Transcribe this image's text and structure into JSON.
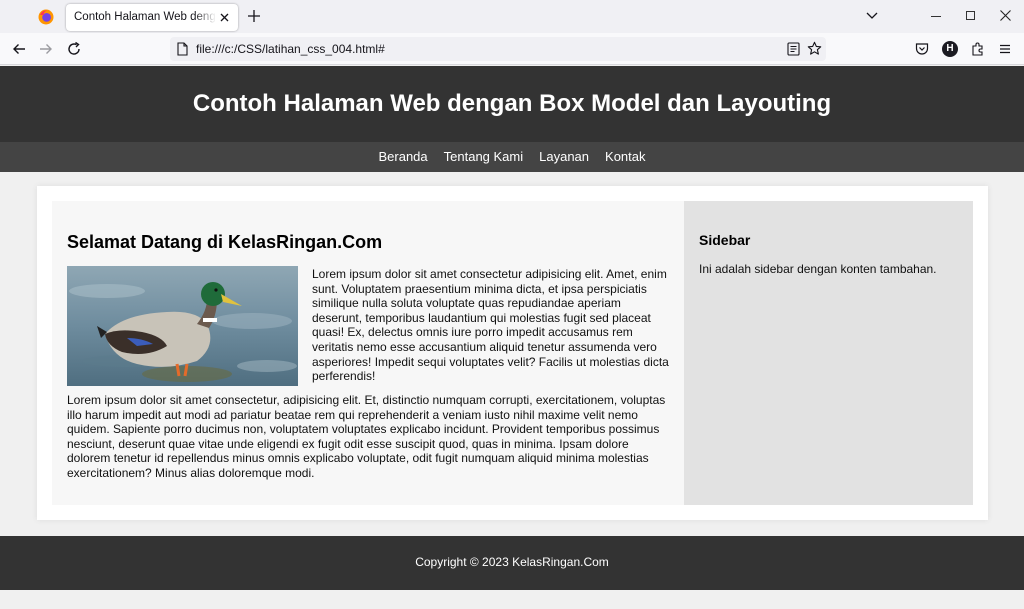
{
  "browser": {
    "tab_title": "Contoh Halaman Web dengan Box Model dan Layouting",
    "url": "file:///c:/CSS/latihan_css_004.html#",
    "avatar_initial": "H"
  },
  "page": {
    "header_title": "Contoh Halaman Web dengan Box Model dan Layouting",
    "nav": [
      "Beranda",
      "Tentang Kami",
      "Layanan",
      "Kontak"
    ],
    "main": {
      "heading": "Selamat Datang di KelasRingan.Com",
      "image": "mallard-duck-photo",
      "paragraph1": "Lorem ipsum dolor sit amet consectetur adipisicing elit. Amet, enim sunt. Voluptatem praesentium minima dicta, et ipsa perspiciatis similique nulla soluta voluptate quas repudiandae aperiam deserunt, temporibus laudantium qui molestias fugit sed placeat quasi! Ex, delectus omnis iure porro impedit accusamus rem veritatis nemo esse accusantium aliquid tenetur assumenda vero asperiores! Impedit sequi voluptates velit? Facilis ut molestias dicta perferendis!",
      "paragraph2": "Lorem ipsum dolor sit amet consectetur, adipisicing elit. Et, distinctio numquam corrupti, exercitationem, voluptas illo harum impedit aut modi ad pariatur beatae rem qui reprehenderit a veniam iusto nihil maxime velit nemo quidem. Sapiente porro ducimus non, voluptatem voluptates explicabo incidunt. Provident temporibus possimus nesciunt, deserunt quae vitae unde eligendi ex fugit odit esse suscipit quod, quas in minima. Ipsam dolore dolorem tenetur id repellendus minus omnis explicabo voluptate, odit fugit numquam aliquid minima molestias exercitationem? Minus alias doloremque modi."
    },
    "sidebar": {
      "heading": "Sidebar",
      "text": "Ini adalah sidebar dengan konten tambahan."
    },
    "footer": "Copyright © 2023 KelasRingan.Com"
  },
  "colors": {
    "header_bg": "#333333",
    "nav_bg": "#444444",
    "main_bg": "#f7f7f7",
    "sidebar_bg": "#e2e2e2",
    "page_bg": "#f0f0f0"
  }
}
